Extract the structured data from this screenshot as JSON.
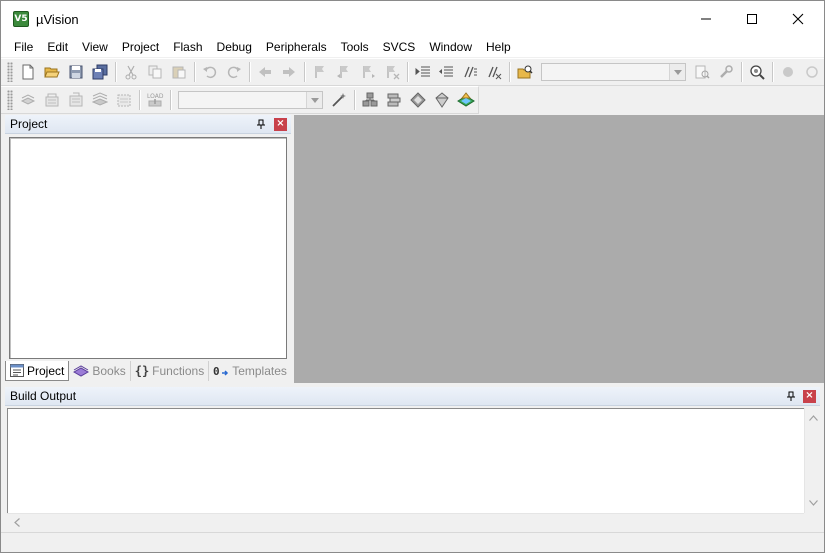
{
  "window": {
    "title": "µVision",
    "app_icon_text": "V5"
  },
  "menu": [
    "File",
    "Edit",
    "View",
    "Project",
    "Flash",
    "Debug",
    "Peripherals",
    "Tools",
    "SVCS",
    "Window",
    "Help"
  ],
  "toolbar2": {
    "load_label": "LOAD"
  },
  "project_panel": {
    "title": "Project",
    "tabs": [
      {
        "label": "Project",
        "icon": "project-tab-icon",
        "active": true
      },
      {
        "label": "Books",
        "icon": "books-icon",
        "active": false
      },
      {
        "label": "Functions",
        "icon": "braces-icon",
        "active": false
      },
      {
        "label": "Templates",
        "icon": "templates-icon",
        "active": false
      }
    ]
  },
  "build_panel": {
    "title": "Build Output"
  },
  "colors": {
    "mdi_background": "#ababab",
    "panel_close": "#c8414b",
    "panel_header": "#dfe7f2"
  }
}
